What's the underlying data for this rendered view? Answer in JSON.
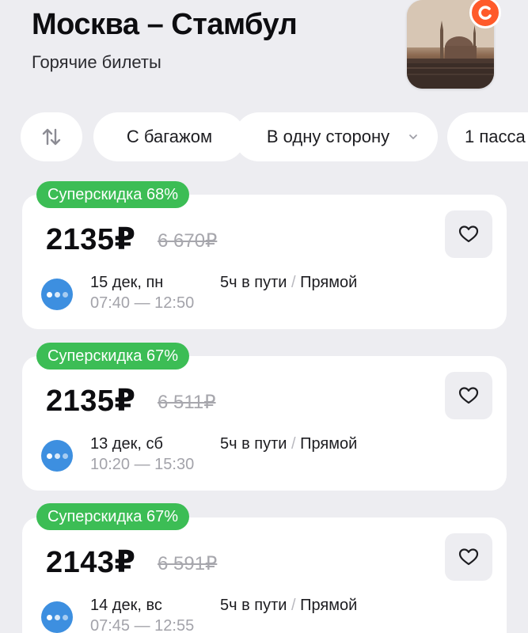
{
  "header": {
    "title": "Москва – Стамбул",
    "subtitle": "Горячие билеты",
    "thumbnail_icon": "istanbul-mosque-photo",
    "brand_icon": "brand-logo-icon",
    "brand_color": "#ff5a2a"
  },
  "filters": {
    "swap_icon": "swap-arrows-icon",
    "baggage_label": "С багажом",
    "direction_label": "В одну сторону",
    "passengers_label": "1 пасса"
  },
  "colors": {
    "discount_badge": "#3cbd55",
    "airline_logo": "#3d8fe0",
    "background": "#ededf1"
  },
  "tickets": [
    {
      "badge": "Суперскидка 68%",
      "price": "2135₽",
      "old_price": "6 670₽",
      "date": "15 дек, пн",
      "times": "07:40 — 12:50",
      "duration": "5ч в пути",
      "separator": "/",
      "type": "Прямой"
    },
    {
      "badge": "Суперскидка 67%",
      "price": "2135₽",
      "old_price": "6 511₽",
      "date": "13 дек, сб",
      "times": "10:20 — 15:30",
      "duration": "5ч в пути",
      "separator": "/",
      "type": "Прямой"
    },
    {
      "badge": "Суперскидка 67%",
      "price": "2143₽",
      "old_price": "6 591₽",
      "date": "14 дек, вс",
      "times": "07:45 — 12:55",
      "duration": "5ч в пути",
      "separator": "/",
      "type": "Прямой"
    }
  ]
}
